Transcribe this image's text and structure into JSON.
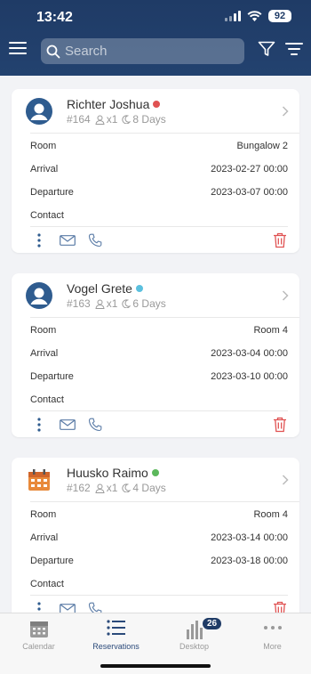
{
  "status_bar": {
    "time": "13:42",
    "battery": "92"
  },
  "search": {
    "placeholder": "Search"
  },
  "colors": {
    "header": "#1f3b66",
    "red_dot": "#e05252",
    "blue_dot": "#5bc0de",
    "green_dot": "#5cb85c",
    "trash": "#e05252",
    "action_icon": "#5a7ba6"
  },
  "reservations": [
    {
      "name": "Richter Joshua",
      "status_color": "red",
      "id": "#164",
      "guests": "x1",
      "nights": "8 Days",
      "avatar": "person-avatar-icon",
      "room_label": "Room",
      "room": "Bungalow 2",
      "arrival_label": "Arrival",
      "arrival": "2023-02-27 00:00",
      "departure_label": "Departure",
      "departure": "2023-03-07 00:00",
      "contact_label": "Contact",
      "contact": ""
    },
    {
      "name": "Vogel Grete",
      "status_color": "blue",
      "id": "#163",
      "guests": "x1",
      "nights": "6 Days",
      "avatar": "person-avatar-icon",
      "room_label": "Room",
      "room": "Room 4",
      "arrival_label": "Arrival",
      "arrival": "2023-03-04 00:00",
      "departure_label": "Departure",
      "departure": "2023-03-10 00:00",
      "contact_label": "Contact",
      "contact": ""
    },
    {
      "name": "Huusko Raimo",
      "status_color": "green",
      "id": "#162",
      "guests": "x1",
      "nights": "4 Days",
      "avatar": "calendar-avatar-icon",
      "room_label": "Room",
      "room": "Room 4",
      "arrival_label": "Arrival",
      "arrival": "2023-03-14 00:00",
      "departure_label": "Departure",
      "departure": "2023-03-18 00:00",
      "contact_label": "Contact",
      "contact": ""
    }
  ],
  "tabs": [
    {
      "label": "Calendar",
      "icon": "calendar-icon",
      "active": false
    },
    {
      "label": "Reservations",
      "icon": "list-icon",
      "active": true
    },
    {
      "label": "Desktop",
      "icon": "bar-chart-icon",
      "active": false,
      "badge": "26"
    },
    {
      "label": "More",
      "icon": "more-horizontal-icon",
      "active": false
    }
  ]
}
